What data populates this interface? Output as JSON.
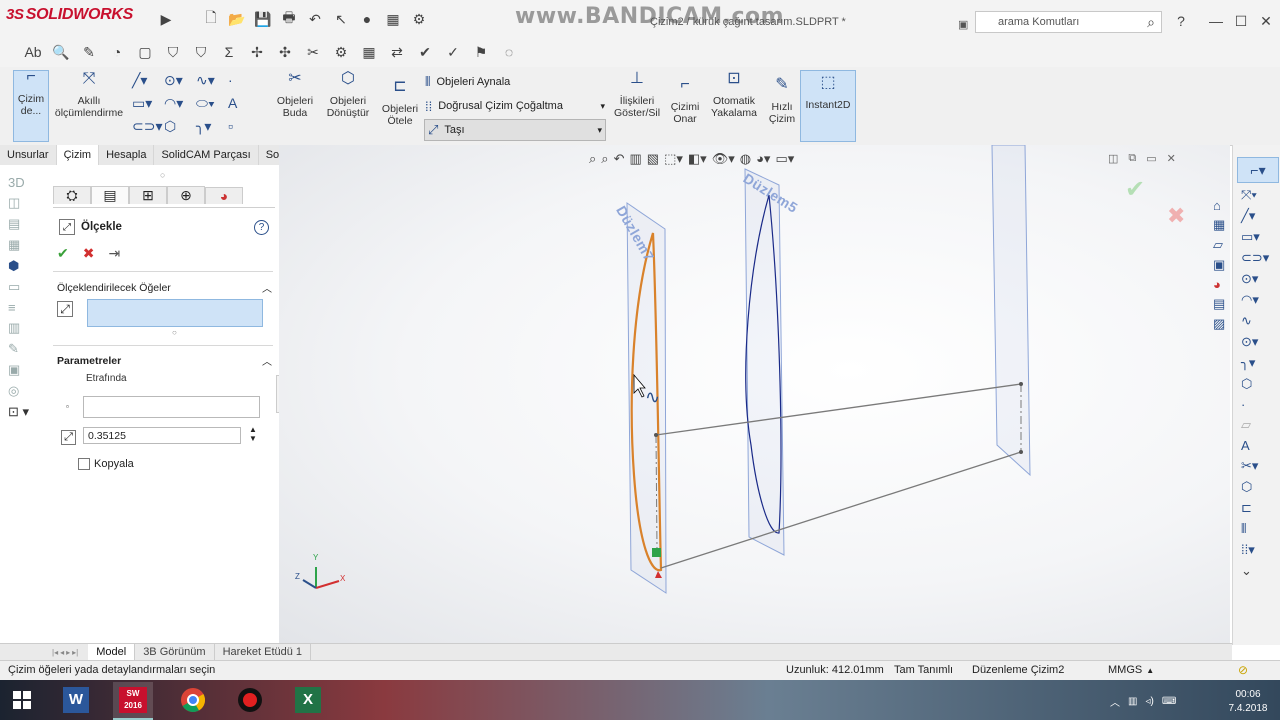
{
  "app": {
    "logo_text": "SOLIDWORKS",
    "logo_ds": "3S",
    "document_title": "Çizim2 / kürük çağınt tasarım.SLDPRT *",
    "watermark": "www.BANDICAM.com",
    "search_placeholder": "arama Komutları",
    "help_label": "?"
  },
  "command_manager": {
    "sketch_button": "Çizim de...",
    "smart_dim_line1": "Akıllı",
    "smart_dim_line2": "ölçümlendirme",
    "trim_line1": "Objeleri",
    "trim_line2": "Buda",
    "convert_line1": "Objeleri",
    "convert_line2": "Dönüştür",
    "offset_line1": "Objeleri",
    "offset_line2": "Ötele",
    "mirror": "Objeleri Aynala",
    "linear_pattern": "Doğrusal Çizim Çoğaltma",
    "move": "Taşı",
    "relations_line1": "İlişkileri",
    "relations_line2": "Göster/Sil",
    "repair_line1": "Çizimi",
    "repair_line2": "Onar",
    "snap_line1": "Otomatik",
    "snap_line2": "Yakalama",
    "rapid_line1": "Hızlı",
    "rapid_line2": "Çizim",
    "instant2d": "Instant2D"
  },
  "tabs": [
    "Unsurlar",
    "Çizim",
    "Hesapla",
    "SolidCAM Parçası",
    "SolidCAM İşler"
  ],
  "active_tab": "Çizim",
  "property_manager": {
    "title": "Ölçekle",
    "help": "?",
    "section_items": "Ölçeklendirilecek Öğeler",
    "section_params": "Parametreler",
    "about_label": "Etrafında",
    "scale_value": "0.35125",
    "copy_label": "Kopyala"
  },
  "viewport": {
    "plane1": "Düzlem7",
    "plane2": "Düzlem5",
    "triad_x": "X",
    "triad_y": "Y",
    "triad_z": "Z"
  },
  "bottom_tabs": [
    "Model",
    "3B Görünüm",
    "Hareket Etüdü 1"
  ],
  "active_bottom_tab": "Model",
  "status": {
    "hint": "Çizim öğeleri yada detaylandırmaları seçin",
    "length": "Uzunluk: 412.01mm",
    "defined": "Tam Tanımlı",
    "editing": "Düzenleme Çizim2",
    "units": "MMGS"
  },
  "taskbar": {
    "time": "00:06",
    "date": "7.4.2018",
    "sw_badge": "SW 2016"
  },
  "colors": {
    "accent": "#2a4f8a",
    "sketch_orange": "#d9822b",
    "plane_blue": "#8fa6d8",
    "ok_green": "#3aa13a",
    "cancel_red": "#d23030"
  }
}
